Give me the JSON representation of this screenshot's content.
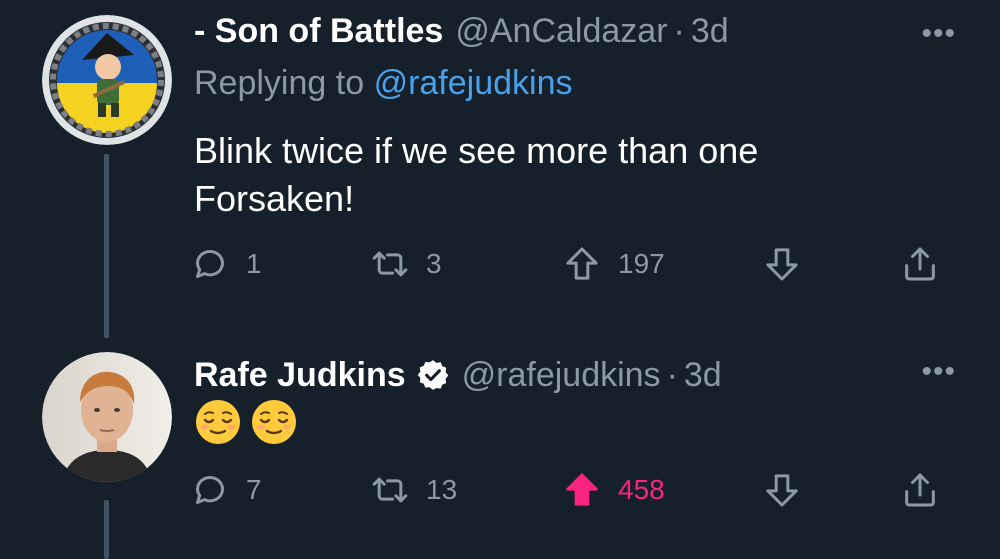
{
  "tweets": [
    {
      "display_name": "- Son of Battles",
      "handle": "@AnCaldazar",
      "dot": "·",
      "time": "3d",
      "replying_prefix": "Replying to",
      "replying_to": "@rafejudkins",
      "text": "Blink twice if we see more than one Forsaken!",
      "more_label": "•••",
      "actions": {
        "replies": "1",
        "retweets": "3",
        "upvotes": "197",
        "upvoted": false
      }
    },
    {
      "display_name": "Rafe Judkins",
      "verified": true,
      "handle": "@rafejudkins",
      "dot": "·",
      "time": "3d",
      "text": "😌😌",
      "emoji_icons": [
        "relieved-face-icon",
        "relieved-face-icon"
      ],
      "more_label": "•••",
      "actions": {
        "replies": "7",
        "retweets": "13",
        "upvotes": "458",
        "upvoted": true
      }
    }
  ],
  "colors": {
    "background": "#15202b",
    "secondary_text": "#8b98a5",
    "link": "#4aa1eb",
    "upvote_active": "#f9247f",
    "thread_line": "#425364"
  }
}
